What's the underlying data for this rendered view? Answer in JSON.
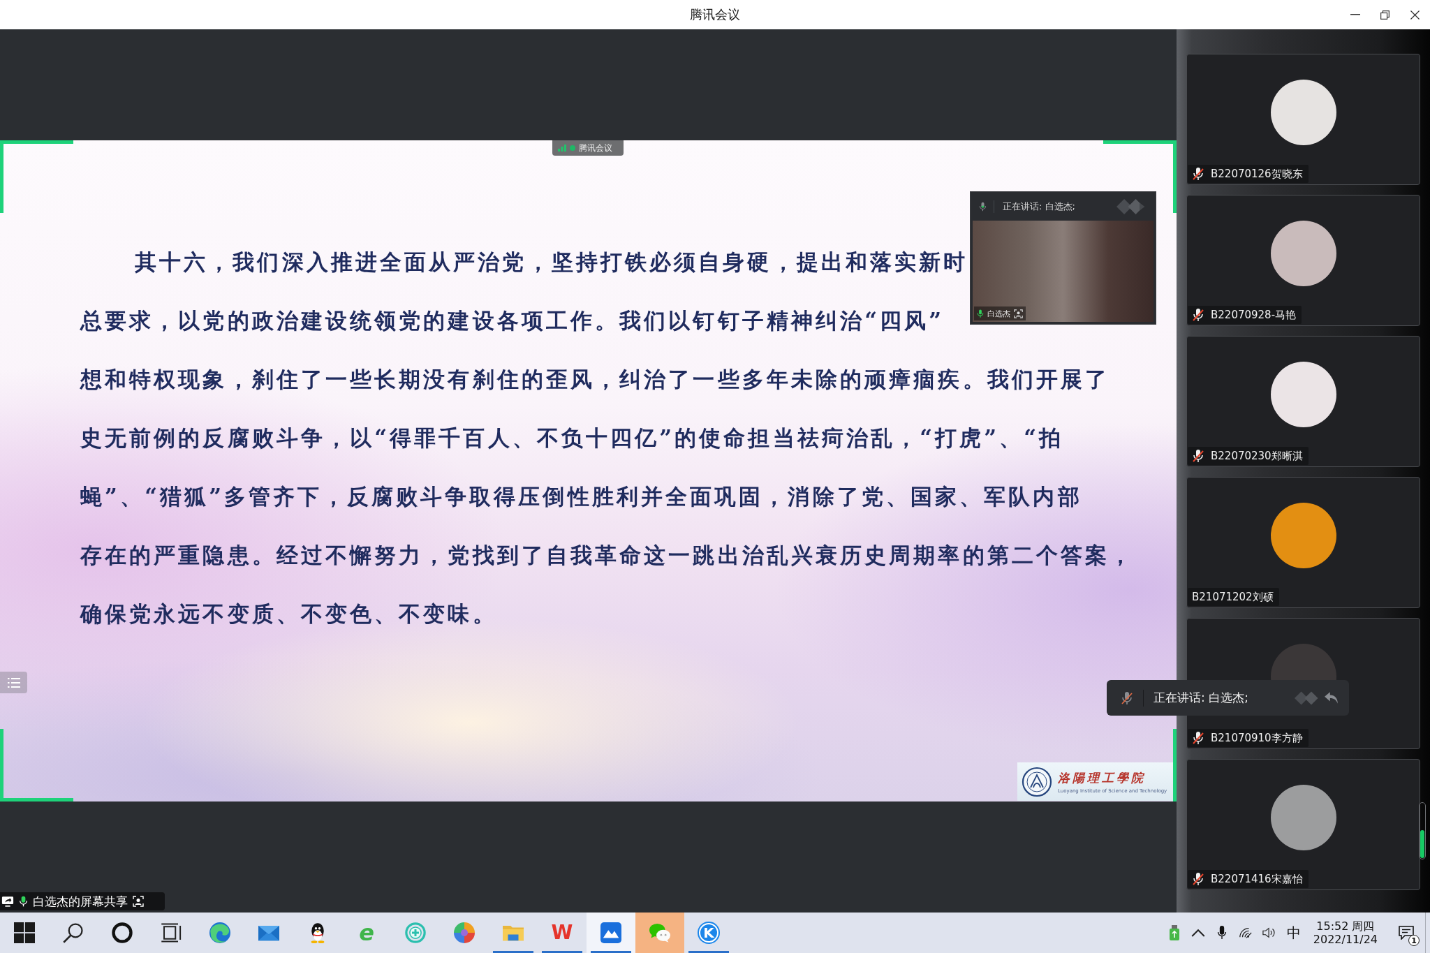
{
  "window": {
    "title": "腾讯会议"
  },
  "shared_screen": {
    "app_badge": "腾讯会议",
    "slide": {
      "lines": [
        "其十六，我们深入推进全面从严治党，坚持打铁必须自身硬，提出和落实新时",
        "总要求，以党的政治建设统领党的建设各项工作。我们以钉钉子精神纠治“四风”",
        "想和特权现象，刹住了一些长期没有刹住的歪风，纠治了一些多年未除的顽瘴痼疾。我们开展了",
        "史无前例的反腐败斗争，以“得罪千百人、不负十四亿”的使命担当祛疴治乱，“打虎”、“拍",
        "蝇”、“猎狐”多管齐下，反腐败斗争取得压倒性胜利并全面巩固，消除了党、国家、军队内部",
        "存在的严重隐患。经过不懈努力，党找到了自我革命这一跳出治乱兴衰历史周期率的第二个答案，",
        "确保党永远不变质、不变色、不变味。"
      ],
      "logo": {
        "name": "洛陽理工學院",
        "subtitle": "Luoyang Institute of Science and Technology"
      }
    },
    "sharer_label": "白选杰的屏幕共享"
  },
  "speaker_window": {
    "header": "正在讲话: 白选杰;",
    "video_name": "白选杰"
  },
  "speaking_bar": {
    "text": "正在讲话: 白选杰;"
  },
  "participants": [
    {
      "name": "B22070126贺晓东",
      "muted": true,
      "color": "#e6e3e1"
    },
    {
      "name": "B22070928-马艳",
      "muted": true,
      "color": "#c9bbbb"
    },
    {
      "name": "B22070230郑晰淇",
      "muted": true,
      "color": "#ebe4e6"
    },
    {
      "name": "B21071202刘硕",
      "muted": false,
      "color": "#e38f12"
    },
    {
      "name": "B21070910李方静",
      "muted": true,
      "color": "#3b3738"
    },
    {
      "name": "B22071416宋嘉怡",
      "muted": true,
      "color": "#9c9d9e"
    }
  ],
  "taskbar": {
    "apps": [
      {
        "kind": "windows",
        "running": false,
        "active": false,
        "attention": false
      },
      {
        "kind": "search",
        "running": false,
        "active": false,
        "attention": false
      },
      {
        "kind": "ring",
        "running": false,
        "active": false,
        "attention": false
      },
      {
        "kind": "task_view",
        "running": false,
        "active": false,
        "attention": false
      },
      {
        "kind": "swirl",
        "running": false,
        "active": false,
        "attention": false
      },
      {
        "kind": "envelope",
        "running": false,
        "active": false,
        "attention": false
      },
      {
        "kind": "penguin",
        "running": false,
        "active": false,
        "attention": false
      },
      {
        "kind": "e_logo",
        "glyph": "e",
        "running": false,
        "active": false,
        "attention": false
      },
      {
        "kind": "cross_circle",
        "running": false,
        "active": false,
        "attention": false
      },
      {
        "kind": "pinwheel",
        "running": false,
        "active": false,
        "attention": false
      },
      {
        "kind": "folder",
        "running": true,
        "active": false,
        "attention": false
      },
      {
        "kind": "w_logo",
        "glyph": "W",
        "running": true,
        "active": false,
        "attention": false
      },
      {
        "kind": "mountain",
        "running": true,
        "active": true,
        "attention": false
      },
      {
        "kind": "chat",
        "running": false,
        "active": false,
        "attention": true
      },
      {
        "kind": "k_logo",
        "glyph": "K",
        "running": true,
        "active": false,
        "attention": false
      }
    ],
    "tray": {
      "input_method": "中",
      "time": "15:52 周四",
      "date": "2022/11/24",
      "notifications": "1"
    }
  }
}
